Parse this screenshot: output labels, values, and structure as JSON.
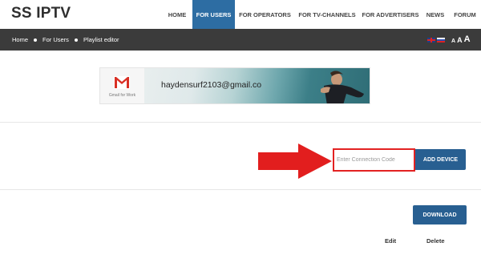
{
  "app": {
    "logo": "SS IPTV"
  },
  "nav": {
    "items": [
      {
        "label": "HOME",
        "active": false
      },
      {
        "label": "FOR USERS",
        "active": true
      },
      {
        "label": "FOR OPERATORS",
        "active": false
      },
      {
        "label": "FOR TV-CHANNELS",
        "active": false
      },
      {
        "label": "FOR ADVERTISERS",
        "active": false
      },
      {
        "label": "NEWS",
        "active": false
      },
      {
        "label": "FORUM",
        "active": false
      }
    ]
  },
  "breadcrumb": {
    "items": [
      "Home",
      "For Users",
      "Playlist editor"
    ]
  },
  "lang": {
    "flags": [
      "flag-uk-icon",
      "flag-ru-icon"
    ]
  },
  "font_size_controls": {
    "small": "A",
    "medium": "A",
    "large": "A"
  },
  "banner": {
    "gmail_caption": "Gmail for Work",
    "email": "haydensurf2103@gmail.co"
  },
  "device": {
    "placeholder": "Enter Connection Code",
    "add_label": "ADD DEVICE"
  },
  "playlist": {
    "download_label": "DOWNLOAD",
    "columns": [
      "Edit",
      "Delete"
    ]
  },
  "colors": {
    "accent": "#285f91",
    "nav_active": "#2d6da3",
    "highlight": "#e32222",
    "bar": "#3b3b3b"
  }
}
